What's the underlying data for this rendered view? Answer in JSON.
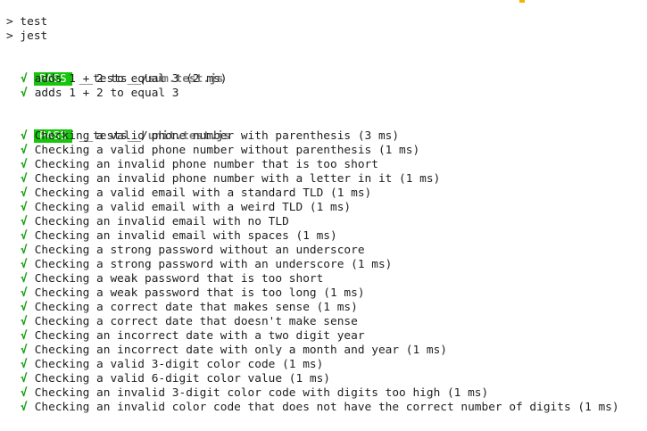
{
  "terminal": {
    "commands": [
      "> test",
      "> jest"
    ],
    "suites": [
      {
        "status": "PASS",
        "dir": "__tests__/",
        "file": "sum.test.js",
        "tests": [
          {
            "name": "adds 1 + 2 to equal 3 (2 ms)"
          },
          {
            "name": "adds 1 + 2 to equal 3"
          }
        ]
      },
      {
        "status": "PASS",
        "dir": "__tests__/",
        "file": "unit.test.js",
        "tests": [
          {
            "name": "Checking a valid phone number with parenthesis (3 ms)"
          },
          {
            "name": "Checking a valid phone number without parenthesis (1 ms)"
          },
          {
            "name": "Checking an invalid phone number that is too short"
          },
          {
            "name": "Checking an invalid phone number with a letter in it (1 ms)"
          },
          {
            "name": "Checking a valid email with a standard TLD (1 ms)"
          },
          {
            "name": "Checking a valid email with a weird TLD (1 ms)"
          },
          {
            "name": "Checking an invalid email with no TLD"
          },
          {
            "name": "Checking an invalid email with spaces (1 ms)"
          },
          {
            "name": "Checking a strong password without an underscore"
          },
          {
            "name": "Checking a strong password with an underscore (1 ms)"
          },
          {
            "name": "Checking a weak password that is too short"
          },
          {
            "name": "Checking a weak password that is too long (1 ms)"
          },
          {
            "name": "Checking a correct date that makes sense (1 ms)"
          },
          {
            "name": "Checking a correct date that doesn't make sense"
          },
          {
            "name": "Checking an incorrect date with a two digit year"
          },
          {
            "name": "Checking an incorrect date with only a month and year (1 ms)"
          },
          {
            "name": "Checking a valid 3-digit color code (1 ms)"
          },
          {
            "name": "Checking a valid 6-digit color value (1 ms)"
          },
          {
            "name": "Checking an invalid 3-digit color code with digits too high (1 ms)"
          },
          {
            "name": "Checking an invalid color code that does not have the correct number of digits (1 ms)"
          }
        ]
      }
    ],
    "check_glyph": "√"
  },
  "colors": {
    "pass_badge": "#16c60c",
    "check": "#13a10e",
    "file_name": "#7a7a7a",
    "text": "#1e1e1e"
  }
}
